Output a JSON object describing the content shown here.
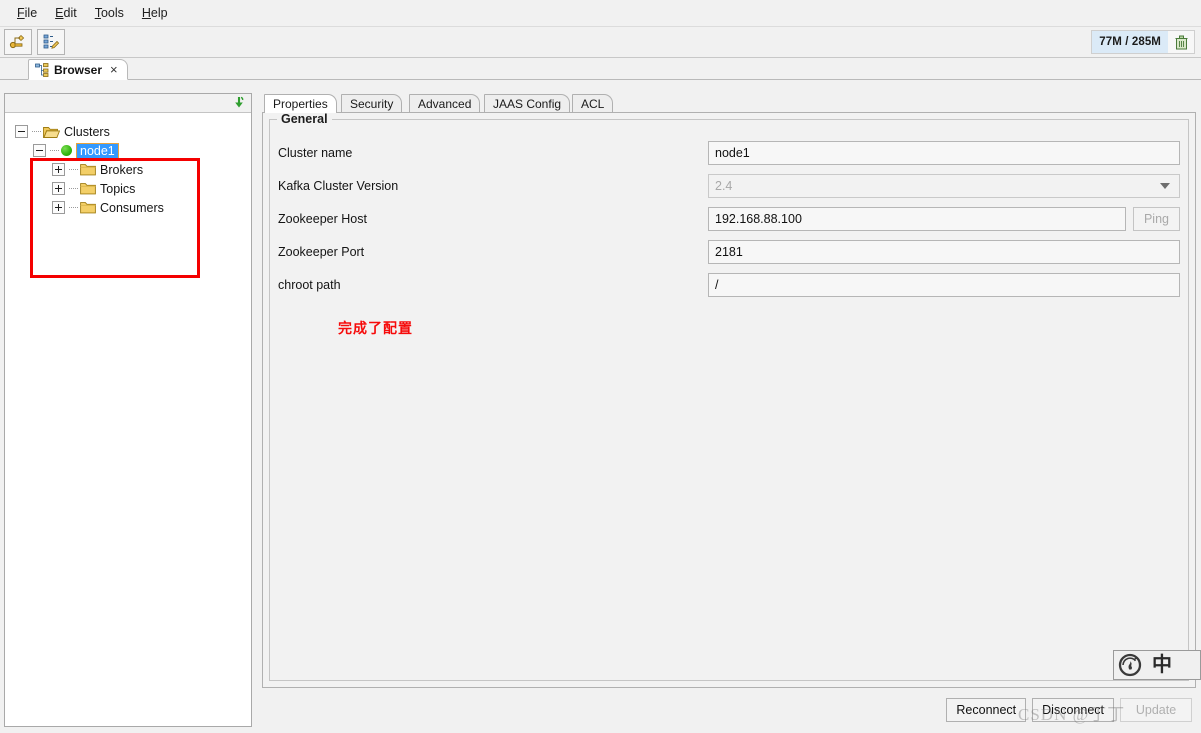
{
  "menubar": {
    "items": [
      {
        "mnemonic": "F",
        "rest": "ile",
        "name": "file"
      },
      {
        "mnemonic": "E",
        "rest": "dit",
        "name": "edit"
      },
      {
        "mnemonic": "T",
        "rest": "ools",
        "name": "tools"
      },
      {
        "mnemonic": "H",
        "rest": "elp",
        "name": "help"
      }
    ]
  },
  "toolbar": {
    "buttons": [
      {
        "icon": "add-cluster-icon",
        "label": ""
      },
      {
        "icon": "edit-tree-icon",
        "label": ""
      }
    ],
    "memory": {
      "text": "77M / 285M",
      "trash_icon": "trash-icon",
      "bar_color": "#dbeaf7"
    }
  },
  "window_tabs": [
    {
      "label": "Browser",
      "icon": "tree-browser-icon",
      "close": "×",
      "active": true
    }
  ],
  "tree": {
    "collapse_icon": "collapse-all-icon",
    "root": {
      "label": "Clusters",
      "icon": "folder-open-icon",
      "expanded": true
    },
    "cluster": {
      "label": "node1",
      "status": "connected",
      "status_color": "#35b811",
      "expanded": true,
      "selected": true
    },
    "children": [
      {
        "label": "Brokers",
        "icon": "folder-icon",
        "expanded": false
      },
      {
        "label": "Topics",
        "icon": "folder-icon",
        "expanded": false
      },
      {
        "label": "Consumers",
        "icon": "folder-icon",
        "expanded": false
      }
    ],
    "annotation_box_color": "#f40000"
  },
  "property_tabs": [
    {
      "label": "Properties",
      "active": true
    },
    {
      "label": "Security",
      "active": false
    },
    {
      "label": "Advanced",
      "active": false
    },
    {
      "label": "JAAS Config",
      "active": false
    },
    {
      "label": "ACL",
      "active": false
    }
  ],
  "general": {
    "title": "General",
    "fields": [
      {
        "label": "Cluster name",
        "value": "node1",
        "placeholder": "",
        "type": "text",
        "disabled": false,
        "name": "cluster-name"
      },
      {
        "label": "Kafka Cluster Version",
        "value": "2.4",
        "placeholder": "",
        "type": "combo",
        "disabled": true,
        "name": "kafka-cluster-version"
      },
      {
        "label": "Zookeeper Host",
        "value": "192.168.88.100",
        "placeholder": "",
        "type": "text-with-button",
        "button_label": "Ping",
        "button_disabled": true,
        "disabled": false,
        "name": "zookeeper-host"
      },
      {
        "label": "Zookeeper Port",
        "value": "2181",
        "placeholder": "",
        "type": "text",
        "disabled": false,
        "name": "zookeeper-port"
      },
      {
        "label": "chroot path",
        "value": "/",
        "placeholder": "",
        "type": "text",
        "disabled": false,
        "name": "chroot-path"
      }
    ]
  },
  "annotation": {
    "text": "完成了配置",
    "color": "#f60b0b"
  },
  "footer_buttons": [
    {
      "label": "Reconnect",
      "disabled": false,
      "name": "reconnect"
    },
    {
      "label": "Disconnect",
      "disabled": false,
      "name": "disconnect"
    },
    {
      "label": "Update",
      "disabled": true,
      "name": "update"
    }
  ],
  "ime": {
    "logo_icon": "sogou-ime-icon",
    "mode": "中"
  },
  "watermark": {
    "text": "CSDN @丁丁"
  }
}
